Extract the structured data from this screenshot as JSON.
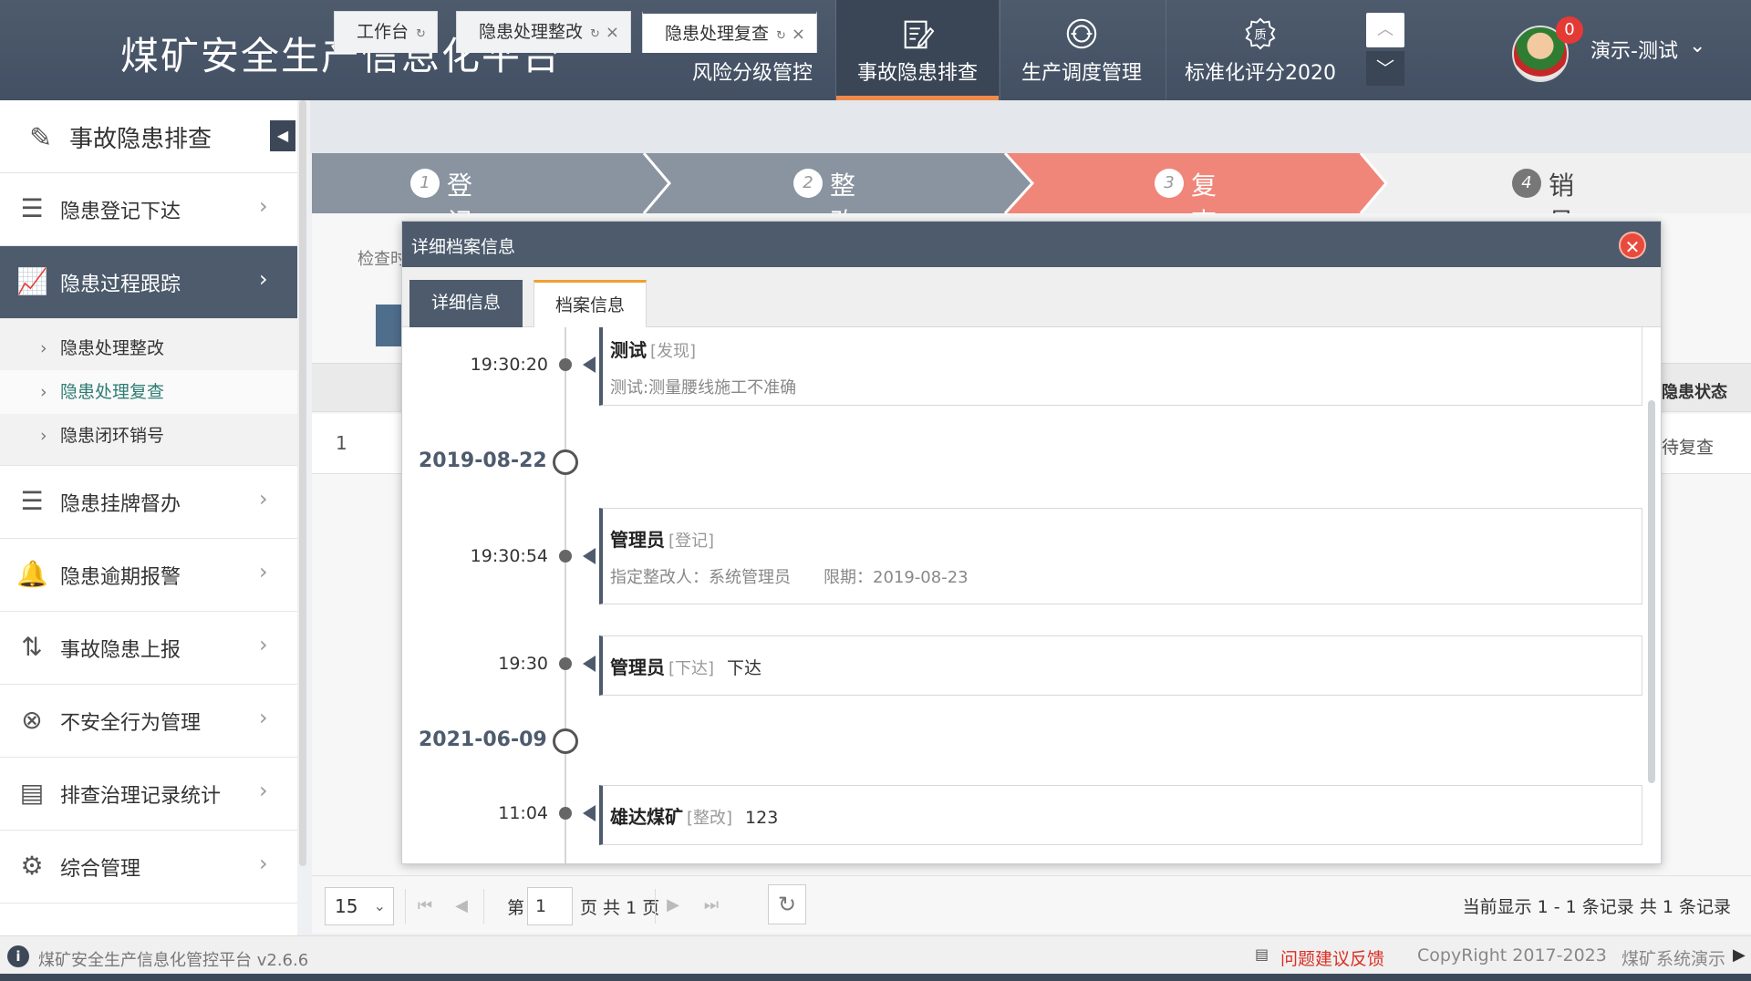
{
  "app": {
    "title": "煤矿安全生产信息化平台"
  },
  "nav": {
    "items": [
      {
        "label": "风险分级管控",
        "icon": "bell-plus-icon"
      },
      {
        "label": "事故隐患排查",
        "icon": "edit-note-icon"
      },
      {
        "label": "生产调度管理",
        "icon": "dispatch-icon"
      },
      {
        "label": "标准化评分2020",
        "icon": "quality-icon"
      }
    ],
    "active_index": 1
  },
  "user": {
    "name": "演示-测试",
    "badge": "0"
  },
  "sidebar": {
    "title": "事故隐患排查",
    "items": [
      {
        "label": "隐患登记下达",
        "icon": "list-icon"
      },
      {
        "label": "隐患过程跟踪",
        "icon": "chart-trend-icon"
      },
      {
        "label": "隐患挂牌督办",
        "icon": "list-icon"
      },
      {
        "label": "隐患逾期报警",
        "icon": "alarm-icon"
      },
      {
        "label": "事故隐患上报",
        "icon": "report-icon"
      },
      {
        "label": "不安全行为管理",
        "icon": "circle-x-icon"
      },
      {
        "label": "排查治理记录统计",
        "icon": "table-icon"
      },
      {
        "label": "综合管理",
        "icon": "manage-icon"
      }
    ],
    "sub_items": [
      "隐患处理整改",
      "隐患处理复查",
      "隐患闭环销号"
    ]
  },
  "tabs": [
    {
      "label": "工作台"
    },
    {
      "label": "隐患处理整改"
    },
    {
      "label": "隐患处理复查"
    }
  ],
  "steps": [
    {
      "num": "1",
      "label": "登记下达"
    },
    {
      "num": "2",
      "label": "整改"
    },
    {
      "num": "3",
      "label": "复查"
    },
    {
      "num": "4",
      "label": "销号"
    }
  ],
  "background": {
    "search_label": "检查时",
    "row_num": "1",
    "status_header": "隐患状态",
    "status_value": "待复查"
  },
  "modal": {
    "title": "详细档案信息",
    "tabs": [
      "详细信息",
      "档案信息"
    ],
    "timeline": {
      "entry1": {
        "time": "19:30:20",
        "name": "测试",
        "tag": "[发现]",
        "desc": "测试:测量腰线施工不准确"
      },
      "date1": "2019-08-22",
      "entry2": {
        "time": "19:30:54",
        "name": "管理员",
        "tag": "[登记]",
        "assignee": "指定整改人：系统管理员",
        "deadline": "限期：2019-08-23"
      },
      "entry3": {
        "time": "19:30",
        "name": "管理员",
        "tag": "[下达]",
        "extra": "下达"
      },
      "date2": "2021-06-09",
      "entry4": {
        "time": "11:04",
        "name": "雄达煤矿",
        "tag": "[整改]",
        "extra": "123"
      }
    }
  },
  "pager": {
    "page_size": "15",
    "page_prefix": "第",
    "page_value": "1",
    "page_suffix": "页 共 1 页",
    "info": "当前显示 1 - 1 条记录 共 1 条记录"
  },
  "footer": {
    "platform": "煤矿安全生产信息化管控平台 v2.6.6",
    "feedback": "问题建议反馈",
    "copyright": "CopyRight 2017-2023",
    "demo": "煤矿系统演示"
  },
  "colors": {
    "header": "#4d5b6d",
    "step_done": "#8a93a0",
    "step_active": "#f0867a",
    "step_pending": "#f0f0f0",
    "accent_orange": "#f08a4b",
    "close_red": "#e84b3c"
  }
}
